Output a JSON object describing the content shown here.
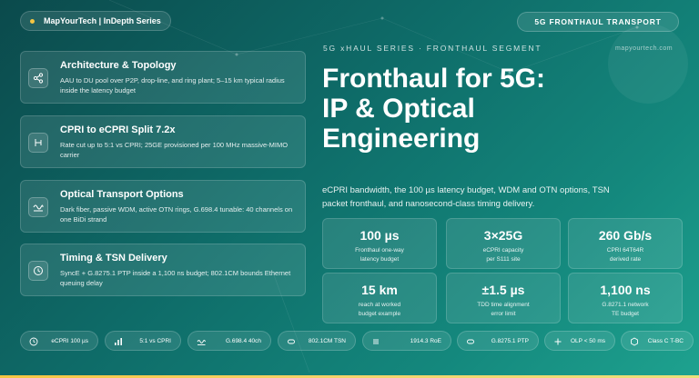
{
  "header": {
    "brand": "MapYourTech | InDepth Series",
    "badge": "5G FRONTHAUL TRANSPORT",
    "series": "5G xHAUL SERIES · FRONTHAUL SEGMENT",
    "site": "mapyourtech.com"
  },
  "hero": {
    "title_lines": [
      "Fronthaul for 5G:",
      "IP & Optical",
      "Engineering"
    ],
    "subtitle": "eCPRI bandwidth, the 100 µs latency budget, WDM and OTN options, TSN packet fronthaul, and nanosecond-class timing delivery."
  },
  "cards": [
    {
      "title": "Architecture & Topology",
      "desc": "AAU to DU pool over P2P, drop-line, and ring plant; 5–15 km typical radius inside the latency budget",
      "icon": "share-nodes-icon"
    },
    {
      "title": "CPRI to eCPRI Split 7.2x",
      "desc": "Rate cut up to 5:1 vs CPRI; 25GE provisioned per 100 MHz massive-MIMO carrier",
      "icon": "split-icon"
    },
    {
      "title": "Optical Transport Options",
      "desc": "Dark fiber, passive WDM, active OTN rings, G.698.4 tunable: 40 channels on one BiDi strand",
      "icon": "wave-icon"
    },
    {
      "title": "Timing & TSN Delivery",
      "desc": "SyncE + G.8275.1 PTP inside a 1,100 ns budget; 802.1CM bounds Ethernet queuing delay",
      "icon": "clock-icon"
    }
  ],
  "stats": [
    {
      "value": "100 µs",
      "line1": "Fronthaul one-way",
      "line2": "latency budget"
    },
    {
      "value": "3×25G",
      "line1": "eCPRI capacity",
      "line2": "per S111 site"
    },
    {
      "value": "260 Gb/s",
      "line1": "CPRI 64T64R",
      "line2": "derived rate"
    },
    {
      "value": "15 km",
      "line1": "reach at worked",
      "line2": "budget example"
    },
    {
      "value": "±1.5 µs",
      "line1": "TDD time alignment",
      "line2": "error limit"
    },
    {
      "value": "1,100 ns",
      "line1": "G.8271.1 network",
      "line2": "TE budget"
    }
  ],
  "pills": [
    {
      "label": "eCPRI 100 µs",
      "icon": "clock-icon"
    },
    {
      "label": "5:1 vs CPRI",
      "icon": "bar-chart-icon"
    },
    {
      "label": "G.698.4 40ch",
      "icon": "wave-icon"
    },
    {
      "label": "802.1CM TSN",
      "icon": "link-icon"
    },
    {
      "label": "1914.3 RoE",
      "icon": "menu-icon"
    },
    {
      "label": "G.8275.1 PTP",
      "icon": "link-icon"
    },
    {
      "label": "OLP < 50 ms",
      "icon": "plus-icon"
    },
    {
      "label": "Class C T-BC",
      "icon": "hexagon-icon"
    }
  ],
  "colors": {
    "accent": "#f5c542",
    "bg_dark": "#0b4a4c",
    "bg_light": "#1ea28f"
  }
}
